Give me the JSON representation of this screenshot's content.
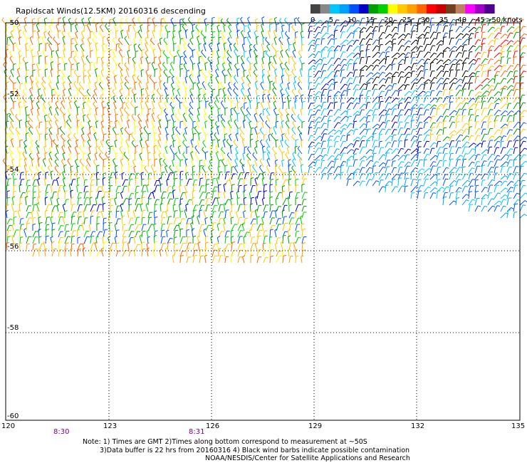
{
  "title": "Rapidscat Winds(12.5KM) 20160316 descending",
  "legend": {
    "colors": [
      "#444444",
      "#888888",
      "#00c8ff",
      "#00a0ff",
      "#0050ff",
      "#0000c8",
      "#00a000",
      "#00d000",
      "#ffff00",
      "#ffc800",
      "#ffa000",
      "#ff6400",
      "#ff0000",
      "#c80000",
      "#704020",
      "#c08060",
      "#ff00ff",
      "#a000c8",
      "#500090"
    ],
    "labels": [
      "0",
      "5",
      "10",
      "15",
      "20",
      "25",
      "30",
      "35",
      "40",
      "45",
      ">50 knots"
    ]
  },
  "lat_labels": [
    "-50",
    "-52",
    "-54",
    "-56",
    "-58",
    "-60"
  ],
  "lon_labels": [
    "120",
    "123",
    "126",
    "129",
    "132",
    "135"
  ],
  "time_labels": [
    "8:30",
    "8:31"
  ],
  "time_color": "#800080",
  "notes": {
    "line1": "Note: 1) Times are GMT 2)Times along bottom correspond to measurement at ~50S",
    "line2": "3)Data buffer is 22 hrs from 20160316 4) Black wind barbs indicate possible contamination",
    "line3": "NOAA/NESDIS/Center for Satellite Applications and Research"
  }
}
